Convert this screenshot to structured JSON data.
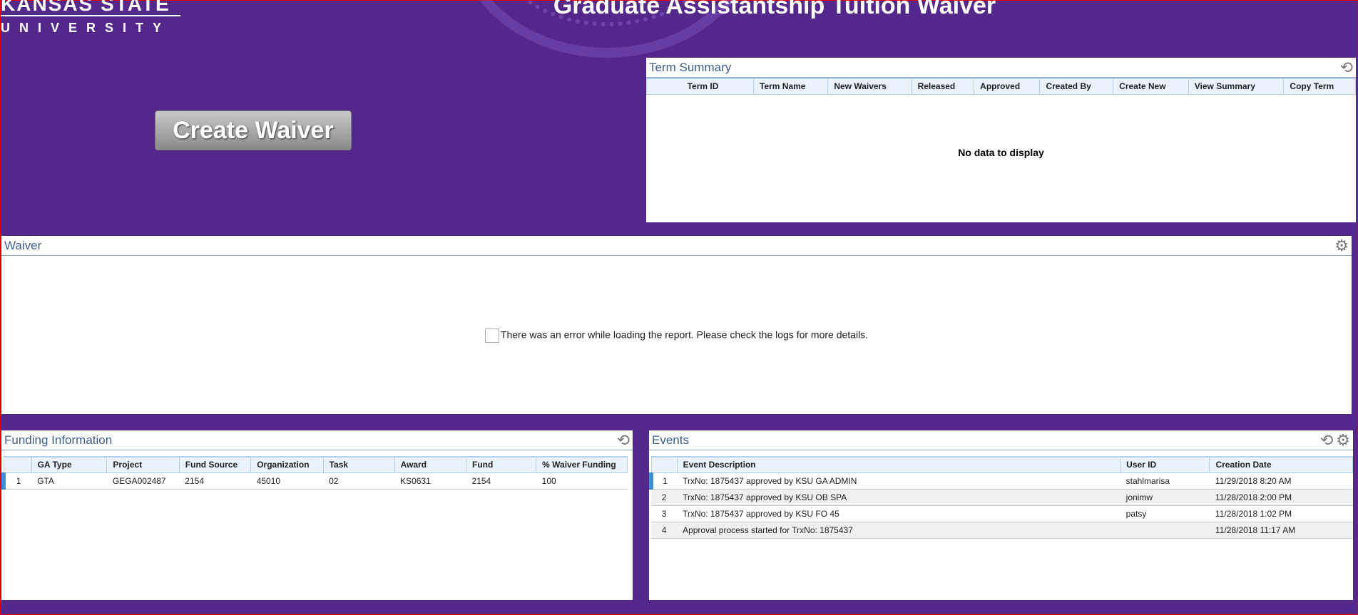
{
  "header": {
    "logo_line1": "KANSAS STATE",
    "logo_line2": "UNIVERSITY",
    "title": "Graduate Assistantship Tuition Waiver"
  },
  "create_waiver": "Create Waiver",
  "term_summary": {
    "title": "Term Summary",
    "columns": [
      "Term ID",
      "Term Name",
      "New Waivers",
      "Released",
      "Approved",
      "Created By",
      "Create New",
      "View Summary",
      "Copy Term"
    ],
    "empty": "No data to display",
    "icons": [
      "refresh-icon"
    ]
  },
  "waiver": {
    "title": "Waiver",
    "error": "There was an error while loading the report. Please check the logs for more details.",
    "icons": [
      "gear-icon"
    ]
  },
  "funding": {
    "title": "Funding Information",
    "columns": [
      "",
      "GA Type",
      "Project",
      "Fund Source",
      "Organization",
      "Task",
      "Award",
      "Fund",
      "% Waiver Funding"
    ],
    "rows": [
      [
        "1",
        "GTA",
        "GEGA002487",
        "2154",
        "45010",
        "02",
        "KS0631",
        "2154",
        "100"
      ]
    ]
  },
  "events": {
    "title": "Events",
    "columns": [
      "",
      "Event Description",
      "User ID",
      "Creation Date"
    ],
    "rows": [
      [
        "1",
        "TrxNo: 1875437 approved by KSU GA ADMIN",
        "stahlmarisa",
        "11/29/2018 8:20 AM"
      ],
      [
        "2",
        "TrxNo: 1875437 approved by KSU OB SPA",
        "jonimw",
        "11/28/2018 2:00 PM"
      ],
      [
        "3",
        "TrxNo: 1875437 approved by KSU FO 45",
        "patsy",
        "11/28/2018 1:02 PM"
      ],
      [
        "4",
        "Approval process started for TrxNo: 1875437",
        "",
        "11/28/2018 11:17 AM"
      ]
    ]
  },
  "colors": {
    "background": "#54288a",
    "header_text": "#3e5f8a",
    "selected_row": "#3d8fd6"
  }
}
